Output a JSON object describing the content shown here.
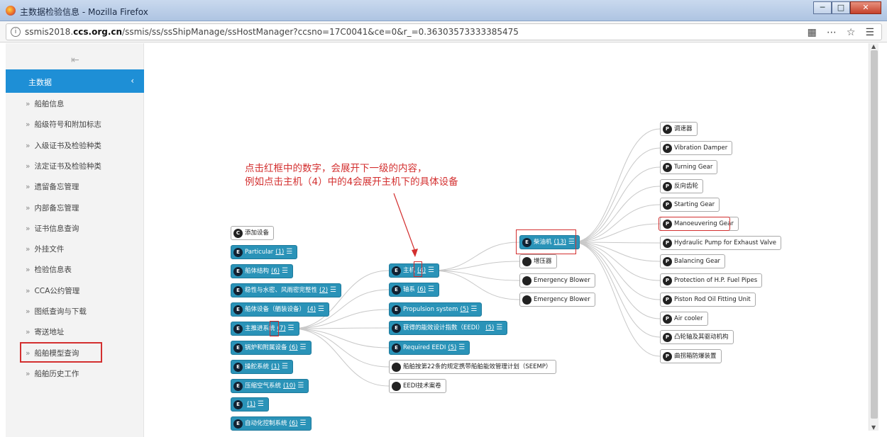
{
  "window": {
    "title": "主数据检验信息 - Mozilla Firefox",
    "url_prefix": "ssmis2018.",
    "url_domain": "ccs.org.cn",
    "url_path": "/ssmis/ss/ssShipManage/ssHostManager?ccsno=17C0041&ce=0&r_=0.36303573333385475"
  },
  "sidebar": {
    "header": "主数据",
    "items": [
      {
        "label": "船舶信息"
      },
      {
        "label": "船级符号和附加标志"
      },
      {
        "label": "入级证书及检验种类"
      },
      {
        "label": "法定证书及检验种类"
      },
      {
        "label": "遗留备忘管理"
      },
      {
        "label": "内部备忘管理"
      },
      {
        "label": "证书信息查询"
      },
      {
        "label": "外挂文件"
      },
      {
        "label": "检验信息表"
      },
      {
        "label": "CCA公约管理"
      },
      {
        "label": "图纸查询与下载"
      },
      {
        "label": "寄送地址"
      },
      {
        "label": "船舶模型查询"
      },
      {
        "label": "船舶历史工作"
      }
    ]
  },
  "annotation": {
    "line1": "点击红框中的数字，会展开下一级的内容，",
    "line2": "例如点击主机（4）中的4会展开主机下的具体设备"
  },
  "tree": {
    "add_device": "添加设备",
    "level1": [
      {
        "label": "Particular",
        "count": "(1)"
      },
      {
        "label": "船体结构",
        "count": "(6)"
      },
      {
        "label": "稳性与水密、风雨密完整性",
        "count": "(2)"
      },
      {
        "label": "船体设备（舾装设备）",
        "count": "(4)"
      },
      {
        "label": "主推进系统",
        "count": "(7)"
      },
      {
        "label": "锅炉和附属设备",
        "count": "(6)"
      },
      {
        "label": "操舵系统",
        "count": "(1)"
      },
      {
        "label": "压缩空气系统",
        "count": "(10)"
      },
      {
        "label": "",
        "count": "(1)"
      },
      {
        "label": "自动化控制系统",
        "count": "(6)"
      }
    ],
    "level2": [
      {
        "label": "主机",
        "count": "(4)"
      },
      {
        "label": "轴系",
        "count": "(6)"
      },
      {
        "label": "Propulsion system",
        "count": "(5)"
      },
      {
        "label": "获得的能效设计指数（EEDI）",
        "count": "(5)"
      },
      {
        "label": "Required EEDI",
        "count": "(5)"
      },
      {
        "label": "船舶按第22条的规定携带船舶能效管理计划（SEEMP）",
        "count": ""
      },
      {
        "label": "EEDI技术案卷",
        "count": ""
      }
    ],
    "level3": [
      {
        "label": "柴油机",
        "count": "(13)"
      },
      {
        "label": "增压器",
        "count": ""
      },
      {
        "label": "Emergency Blower",
        "count": ""
      },
      {
        "label": "Emergency Blower",
        "count": ""
      }
    ],
    "level4": [
      {
        "label": "调速器"
      },
      {
        "label": "Vibration Damper"
      },
      {
        "label": "Turning Gear"
      },
      {
        "label": "反向齿轮"
      },
      {
        "label": "Starting Gear"
      },
      {
        "label": "Manoeuvering Gear"
      },
      {
        "label": "Hydraulic Pump for Exhaust Valve"
      },
      {
        "label": "Balancing Gear"
      },
      {
        "label": "Protection of H.P. Fuel Pipes"
      },
      {
        "label": "Piston Rod Oil Fitting Unit"
      },
      {
        "label": "Air cooler"
      },
      {
        "label": "凸轮轴及其驱动机构"
      },
      {
        "label": "曲拐箱防爆装置"
      }
    ],
    "badges": {
      "E": "E",
      "P": "P",
      "C": "C"
    }
  },
  "colors": {
    "accent": "#1e8fd6",
    "node": "#2a93b8",
    "highlight": "#d32f2f"
  }
}
